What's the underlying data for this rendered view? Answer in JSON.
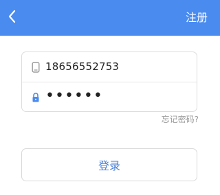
{
  "header": {
    "action_label": "注册",
    "background": "#4a8bf0"
  },
  "form": {
    "phone_value": "18656552753",
    "password_mask": "••••••",
    "forgot_password_label": "忘记密码?"
  },
  "actions": {
    "login_label": "登录"
  },
  "icons": {
    "back": "chevron-left-icon",
    "phone": "phone-icon",
    "password": "lock-icon"
  },
  "colors": {
    "primary": "#4a8bf0",
    "button_text": "#4a7fd6",
    "border": "#dddddd",
    "muted_text": "#9a9a9a"
  }
}
